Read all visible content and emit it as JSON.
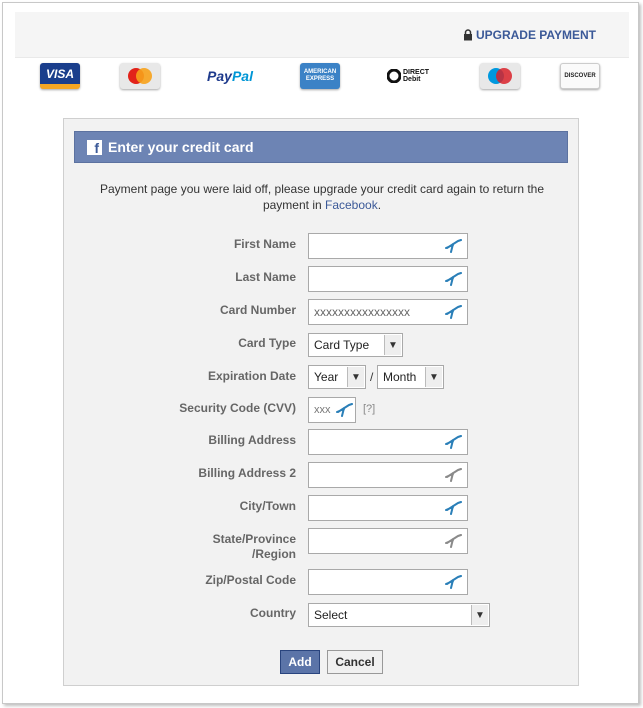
{
  "topbar": {
    "upgrade_label": "UPGRADE PAYMENT"
  },
  "cards": [
    {
      "name": "visa",
      "label": "VISA"
    },
    {
      "name": "mastercard",
      "label": ""
    },
    {
      "name": "paypal",
      "label_a": "Pay",
      "label_b": "Pal"
    },
    {
      "name": "amex",
      "label": "AMERICAN EXPRESS"
    },
    {
      "name": "direct-debit",
      "label": "DIRECT Debit"
    },
    {
      "name": "maestro",
      "label": ""
    },
    {
      "name": "discover",
      "label": "DISCOVER"
    }
  ],
  "panel": {
    "title": "Enter your credit card",
    "intro_text": "Payment page you were laid off, please upgrade your credit card again to return the payment in ",
    "intro_link": "Facebook",
    "intro_end": "."
  },
  "form": {
    "first_name_label": "First Name",
    "last_name_label": "Last Name",
    "card_number_label": "Card Number",
    "card_number_placeholder": "xxxxxxxxxxxxxxxx",
    "card_type_label": "Card Type",
    "card_type_value": "Card Type",
    "expiration_label": "Expiration Date",
    "year_value": "Year",
    "month_value": "Month",
    "date_separator": "/",
    "cvv_label": "Security Code (CVV)",
    "cvv_placeholder": "xxx",
    "cvv_help": "[?]",
    "billing_label": "Billing Address",
    "billing2_label": "Billing Address 2",
    "city_label": "City/Town",
    "state_label_1": "State/Province",
    "state_label_2": "/Region",
    "zip_label": "Zip/Postal Code",
    "country_label": "Country",
    "country_value": "Select"
  },
  "buttons": {
    "add": "Add",
    "cancel": "Cancel"
  },
  "colors": {
    "fb_blue": "#3b5998",
    "header_blue": "#6d84b4",
    "pen_teal": "#2a7fb8",
    "pen_gray": "#8a8a8a"
  }
}
